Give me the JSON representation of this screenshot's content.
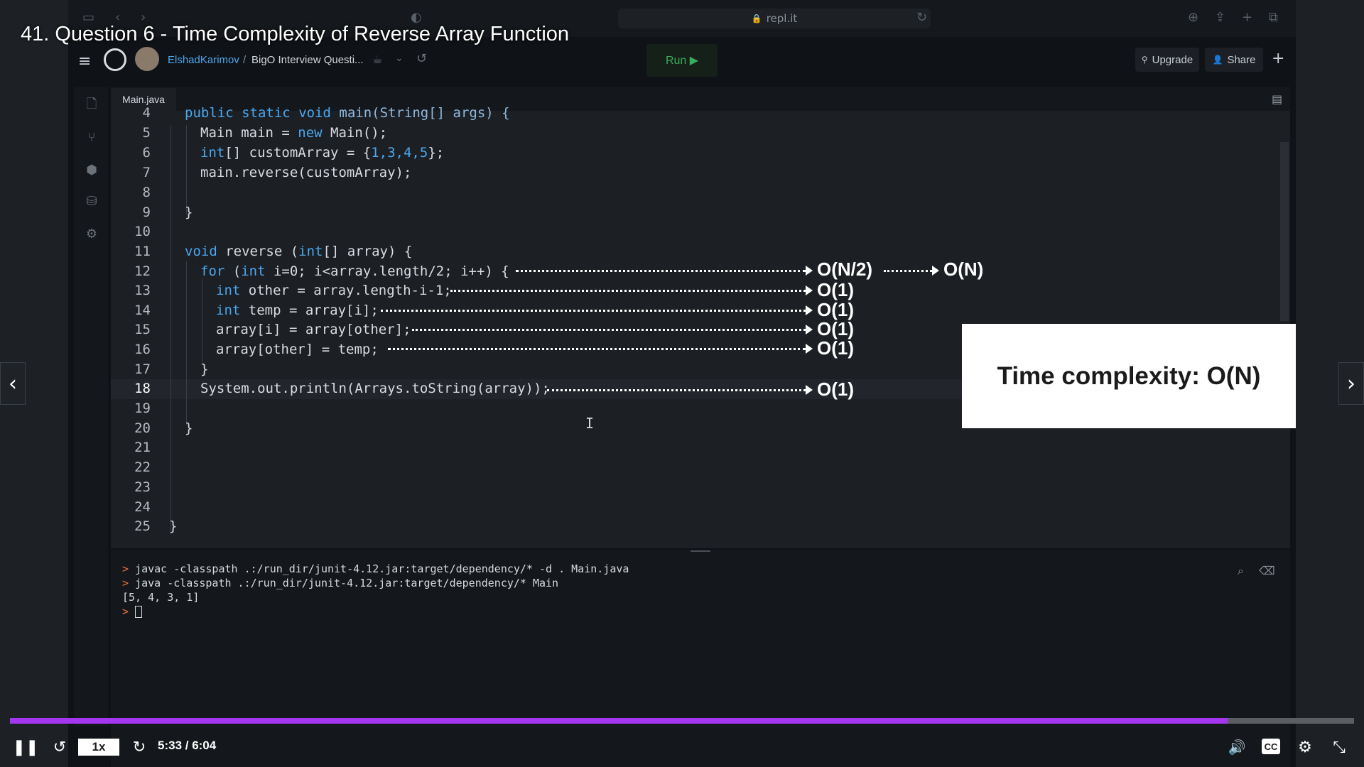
{
  "video": {
    "title": "41. Question 6 - Time Complexity of Reverse Array Function",
    "progress_fraction": 0.906,
    "speed": "1x",
    "time": "5:33 / 6:04"
  },
  "browser": {
    "url": "repl.it"
  },
  "replit": {
    "user": "ElshadKarimov",
    "separator": "/",
    "repl_name": "BigO Interview Questi...",
    "run_label": "Run ▶",
    "upgrade_label": "Upgrade",
    "share_label": "Share",
    "plus_label": "+",
    "tab_label": "Main.java"
  },
  "editor": {
    "lines": [
      {
        "n": "4",
        "text": "public static void main(String[] args) {"
      },
      {
        "n": "5",
        "text": "Main main = new Main();"
      },
      {
        "n": "6",
        "text": "int[] customArray = {1,3,4,5};"
      },
      {
        "n": "7",
        "text": "main.reverse(customArray);"
      },
      {
        "n": "8",
        "text": ""
      },
      {
        "n": "9",
        "text": "}"
      },
      {
        "n": "10",
        "text": ""
      },
      {
        "n": "11",
        "text": "void reverse (int[] array) {"
      },
      {
        "n": "12",
        "text": "for (int i=0; i<array.length/2; i++) {"
      },
      {
        "n": "13",
        "text": "int other = array.length-i-1;"
      },
      {
        "n": "14",
        "text": "int temp = array[i];"
      },
      {
        "n": "15",
        "text": "array[i] = array[other];"
      },
      {
        "n": "16",
        "text": "array[other] = temp;"
      },
      {
        "n": "17",
        "text": "}"
      },
      {
        "n": "18",
        "text": "System.out.println(Arrays.toString(array));"
      },
      {
        "n": "19",
        "text": ""
      },
      {
        "n": "20",
        "text": "}"
      },
      {
        "n": "21",
        "text": ""
      },
      {
        "n": "22",
        "text": ""
      },
      {
        "n": "23",
        "text": ""
      },
      {
        "n": "24",
        "text": ""
      },
      {
        "n": "25",
        "text": "}"
      }
    ]
  },
  "annotations": {
    "line12": "O(N/2)",
    "line12_total": "O(N)",
    "line13": "O(1)",
    "line14": "O(1)",
    "line15": "O(1)",
    "line16": "O(1)",
    "line18": "O(1)",
    "summary": "Time complexity: O(N)"
  },
  "console": {
    "lines": [
      {
        "prompt": ">",
        "text": "javac -classpath .:/run_dir/junit-4.12.jar:target/dependency/* -d . Main.java"
      },
      {
        "prompt": ">",
        "text": "java -classpath .:/run_dir/junit-4.12.jar:target/dependency/* Main"
      },
      {
        "prompt": "",
        "text": "[5, 4, 3, 1]"
      },
      {
        "prompt": ">",
        "text": ""
      }
    ]
  }
}
